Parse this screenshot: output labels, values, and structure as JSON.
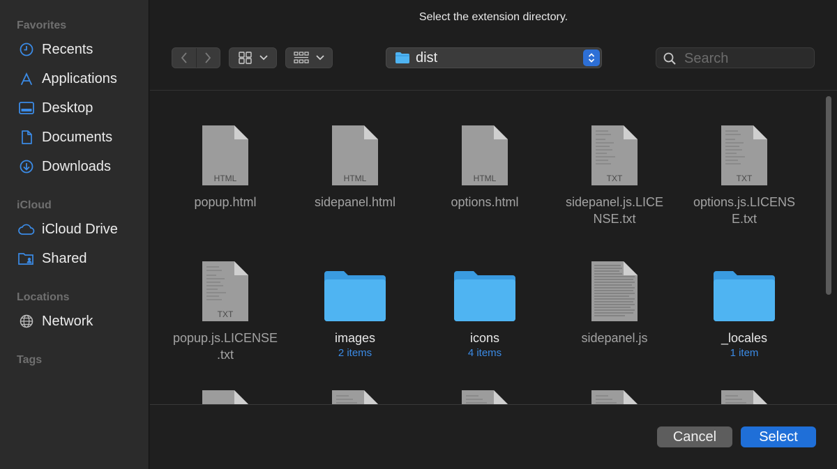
{
  "dialog": {
    "title": "Select the extension directory."
  },
  "sidebar": {
    "sections": [
      {
        "label": "Favorites",
        "items": [
          {
            "label": "Recents",
            "icon": "clock-icon"
          },
          {
            "label": "Applications",
            "icon": "applications-icon"
          },
          {
            "label": "Desktop",
            "icon": "desktop-icon"
          },
          {
            "label": "Documents",
            "icon": "document-icon"
          },
          {
            "label": "Downloads",
            "icon": "download-icon"
          }
        ]
      },
      {
        "label": "iCloud",
        "items": [
          {
            "label": "iCloud Drive",
            "icon": "cloud-icon"
          },
          {
            "label": "Shared",
            "icon": "shared-folder-icon"
          }
        ]
      },
      {
        "label": "Locations",
        "items": [
          {
            "label": "Network",
            "icon": "globe-icon"
          }
        ]
      },
      {
        "label": "Tags",
        "items": []
      }
    ]
  },
  "toolbar": {
    "location": "dist",
    "search_placeholder": "Search"
  },
  "files": [
    {
      "name": "popup.html",
      "kind": "HTML",
      "type": "html-file"
    },
    {
      "name": "sidepanel.html",
      "kind": "HTML",
      "type": "html-file"
    },
    {
      "name": "options.html",
      "kind": "HTML",
      "type": "html-file"
    },
    {
      "name_lines": [
        "sidepanel.js.LICE",
        "NSE.txt"
      ],
      "kind": "TXT",
      "type": "txt-file"
    },
    {
      "name_lines": [
        "options.js.LICENS",
        "E.txt"
      ],
      "kind": "TXT",
      "type": "txt-file"
    },
    {
      "name_lines": [
        "popup.js.LICENSE",
        ".txt"
      ],
      "kind": "TXT",
      "type": "txt-file"
    },
    {
      "name": "images",
      "sub": "2 items",
      "type": "folder"
    },
    {
      "name": "icons",
      "sub": "4 items",
      "type": "folder"
    },
    {
      "name": "sidepanel.js",
      "type": "js-file"
    },
    {
      "name": "_locales",
      "sub": "1 item",
      "type": "folder"
    }
  ],
  "footer": {
    "cancel": "Cancel",
    "select": "Select"
  },
  "colors": {
    "accent": "#1f6fd8",
    "folder": "#4fb4f2",
    "sidebar_icon": "#3b8be6"
  }
}
